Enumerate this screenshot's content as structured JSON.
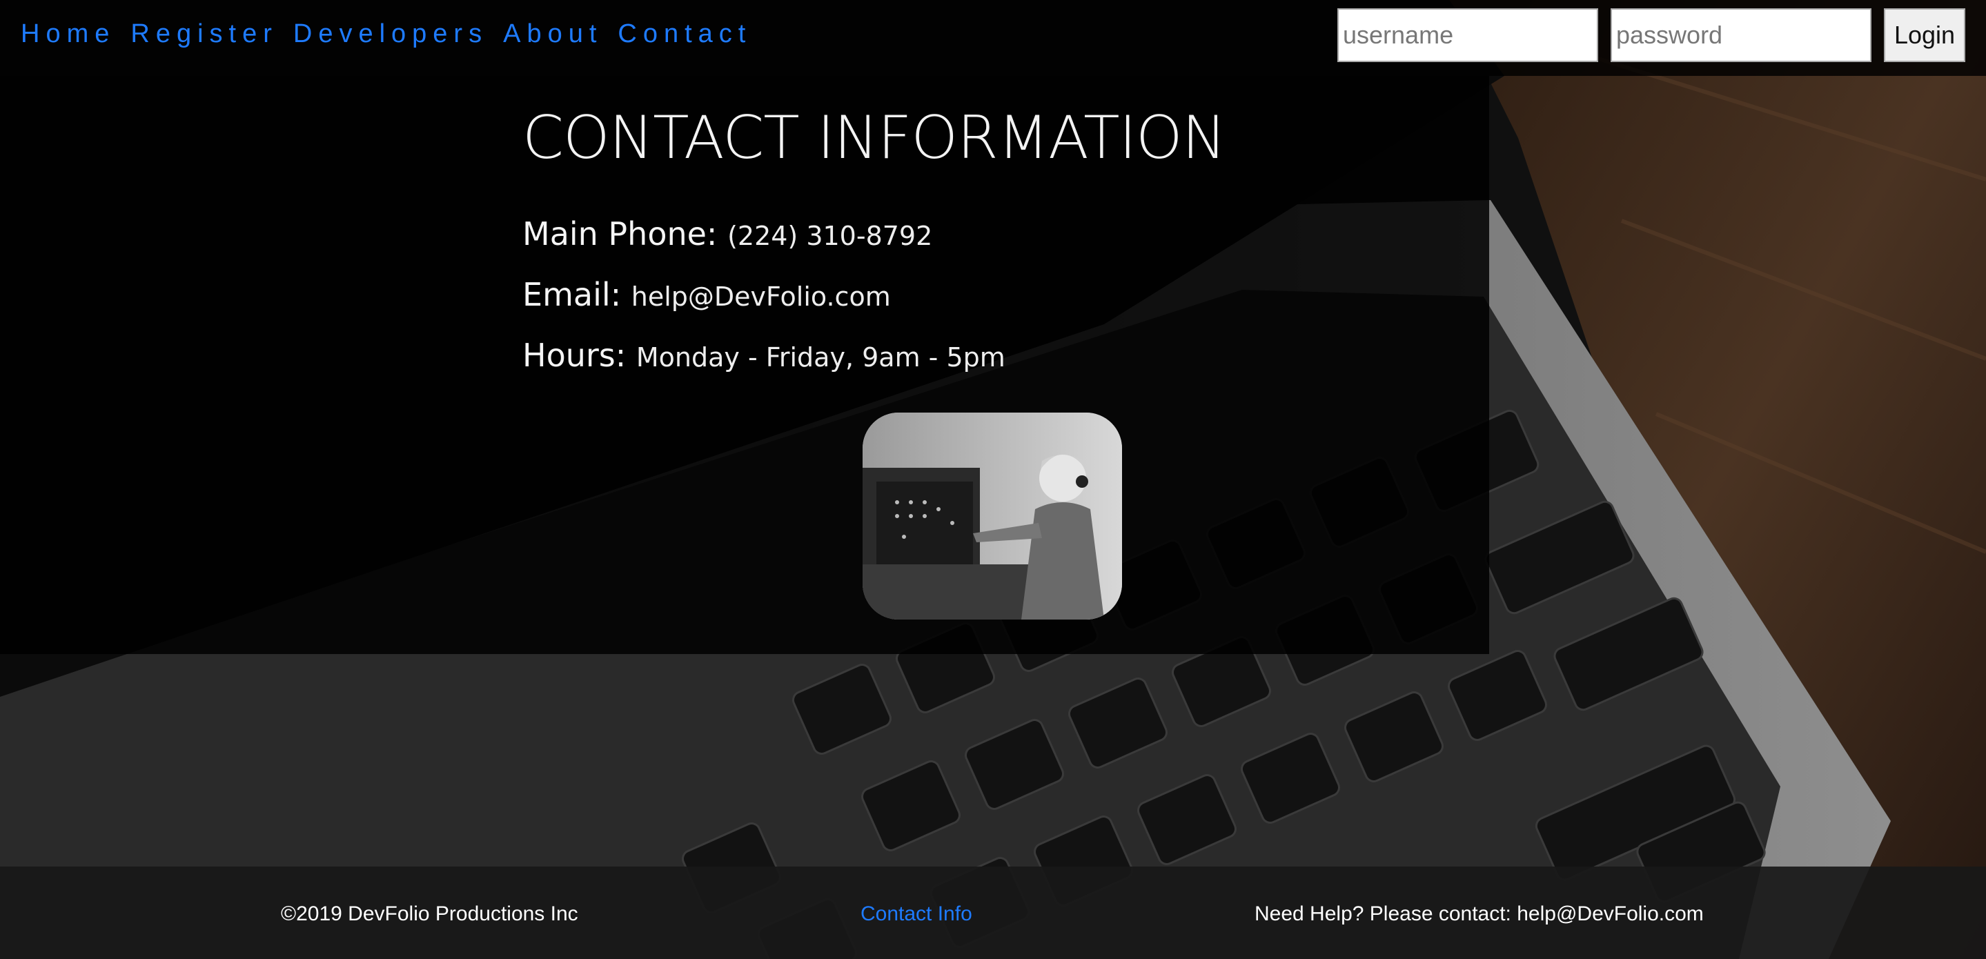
{
  "nav": {
    "items": [
      "Home",
      "Register",
      "Developers",
      "About",
      "Contact"
    ]
  },
  "login": {
    "username_placeholder": "username",
    "password_placeholder": "password",
    "button_label": "Login"
  },
  "contact": {
    "title": "CONTACT INFORMATION",
    "phone_label": "Main Phone:",
    "phone_value": "(224) 310-8792",
    "email_label": "Email:",
    "email_value": "help@DevFolio.com",
    "hours_label": "Hours:",
    "hours_value": "Monday - Friday, 9am - 5pm"
  },
  "footer": {
    "copyright": "©2019 DevFolio Productions Inc",
    "contact_link": "Contact Info",
    "help": "Need Help? Please contact: help@DevFolio.com"
  },
  "colors": {
    "link": "#1e7bff",
    "background": "#000000",
    "footer_bg": "#181818"
  }
}
